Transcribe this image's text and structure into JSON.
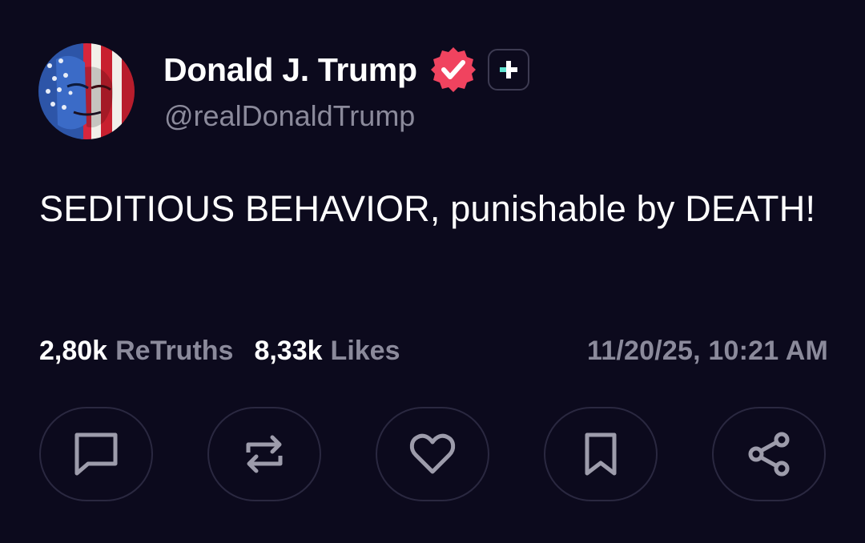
{
  "author": {
    "display_name": "Donald J. Trump",
    "handle": "@realDonaldTrump",
    "verified": true,
    "avatar_icon": "flag-portrait-avatar",
    "verified_badge_icon": "verified-checkmark-icon",
    "subscribe_icon": "plus-badge-icon"
  },
  "post": {
    "text": "SEDITIOUS BEHAVIOR, punishable by DEATH!"
  },
  "stats": {
    "retruths_count": "2,80k",
    "retruths_label": "ReTruths",
    "likes_count": "8,33k",
    "likes_label": "Likes",
    "timestamp": "11/20/25, 10:21 AM"
  },
  "actions": [
    {
      "name": "reply",
      "icon": "comment-icon"
    },
    {
      "name": "retruth",
      "icon": "repost-icon"
    },
    {
      "name": "like",
      "icon": "heart-icon"
    },
    {
      "name": "bookmark",
      "icon": "bookmark-icon"
    },
    {
      "name": "share",
      "icon": "share-icon"
    }
  ],
  "colors": {
    "background": "#0c0a1d",
    "text_primary": "#ffffff",
    "text_secondary": "#8b8a9b",
    "verified_badge": "#f0435f",
    "plus_accent": "#5fe3d0",
    "button_border": "#2a2840",
    "icon_stroke": "#9d9cab"
  }
}
